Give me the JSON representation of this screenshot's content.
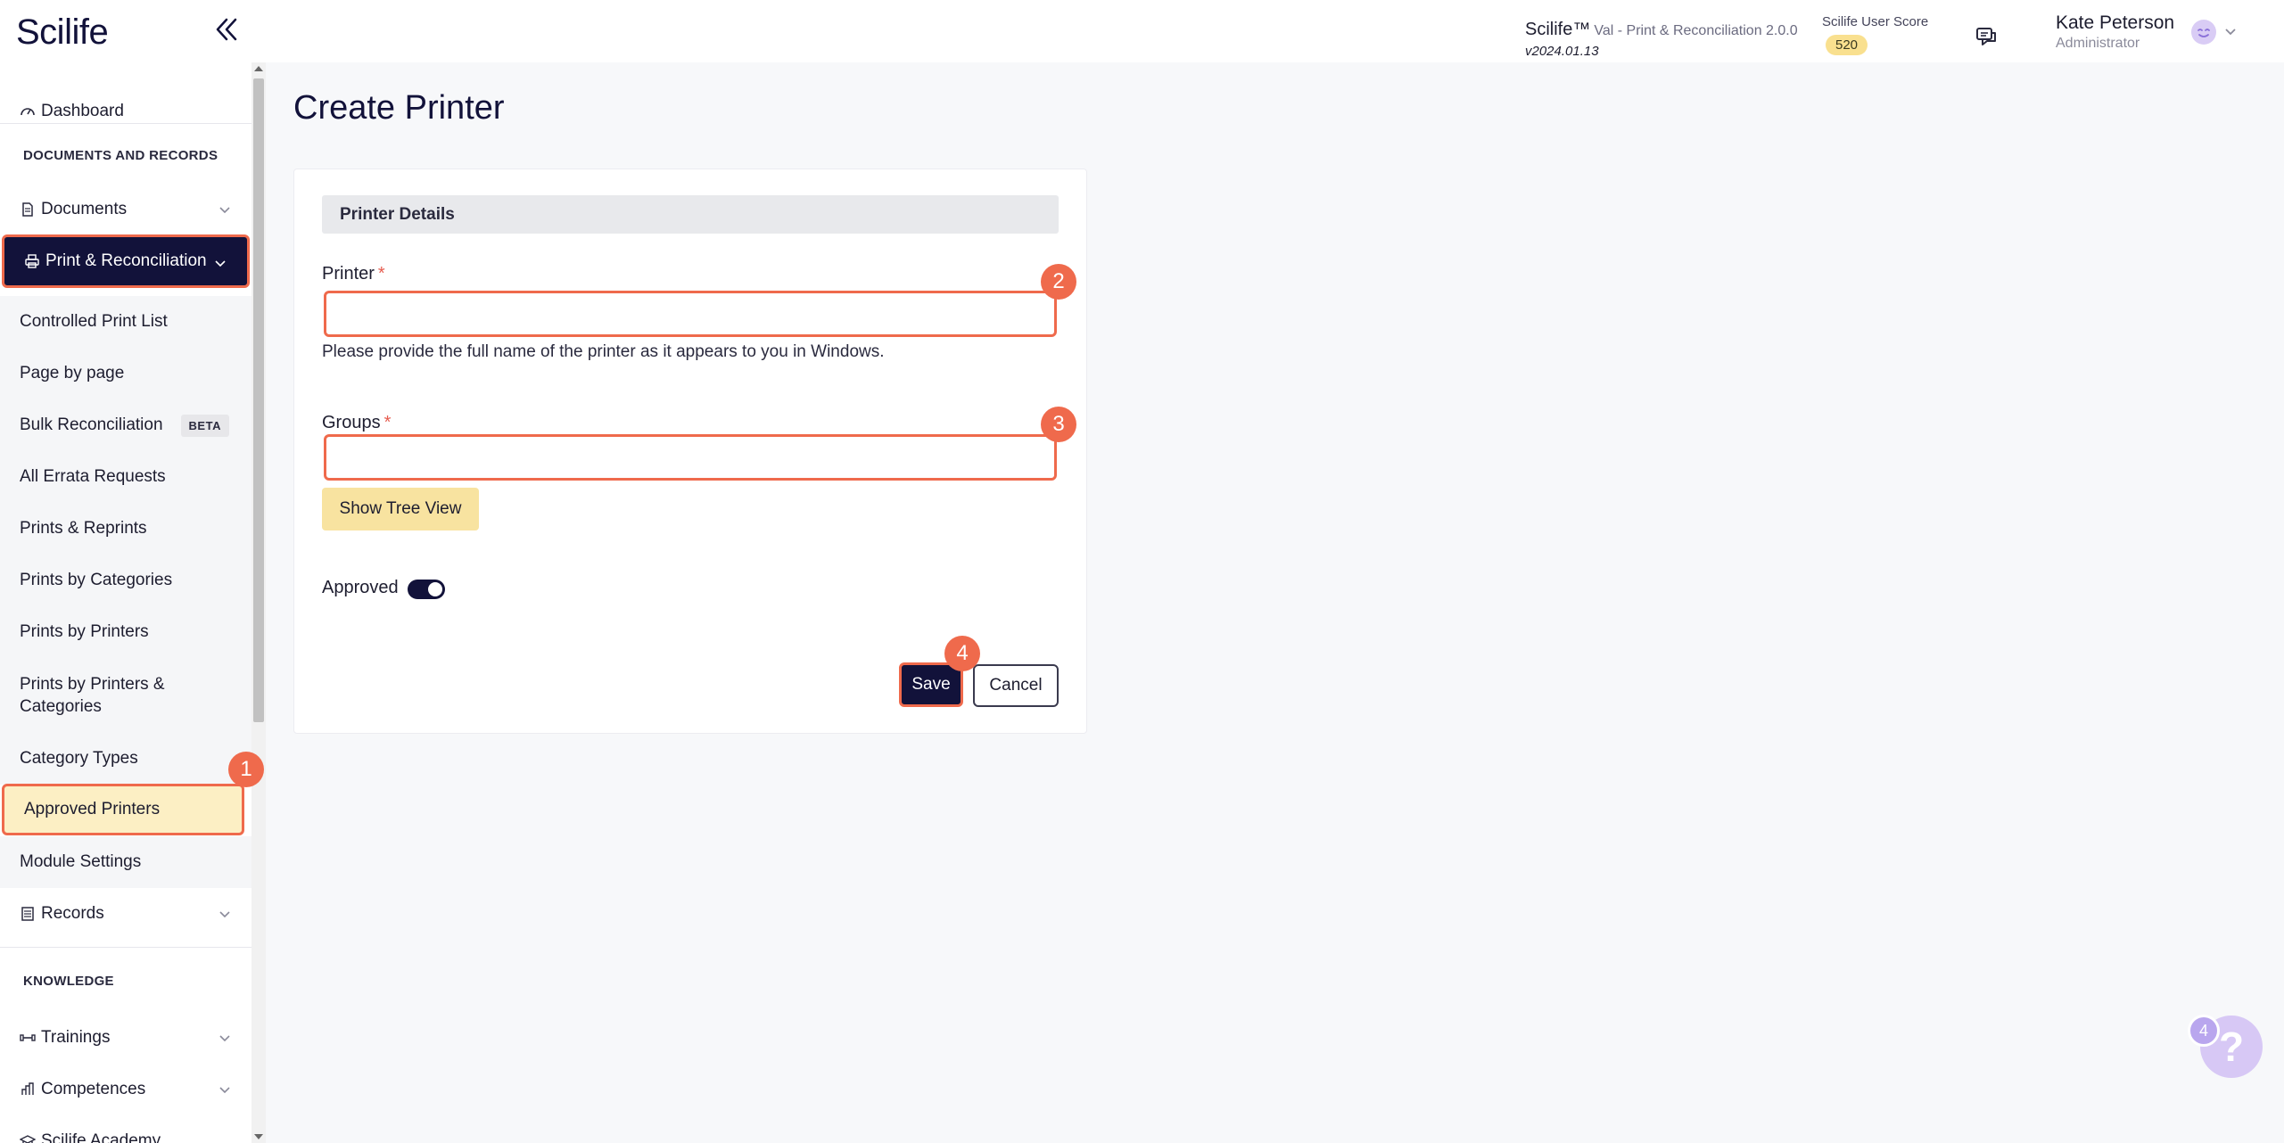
{
  "header": {
    "logo": "Scilife",
    "app_name": "Scilife™",
    "module": "Val - Print & Reconciliation 2.0.0",
    "version": "v2024.01.13",
    "score_label": "Scilife User Score",
    "score_value": "520",
    "user_name": "Kate Peterson",
    "user_role": "Administrator"
  },
  "sidebar": {
    "dashboard": "Dashboard",
    "section_docs": "DOCUMENTS AND RECORDS",
    "documents": "Documents",
    "print_reconciliation": "Print & Reconciliation",
    "sub_items": [
      "Controlled Print List",
      "Page by page",
      "Bulk Reconciliation",
      "All Errata Requests",
      "Prints & Reprints",
      "Prints by Categories",
      "Prints by Printers",
      "Prints by Printers & Categories",
      "Category Types",
      "Approved Printers",
      "Module Settings"
    ],
    "beta_badge": "BETA",
    "records": "Records",
    "section_knowledge": "KNOWLEDGE",
    "trainings": "Trainings",
    "competences": "Competences",
    "academy": "Scilife Academy"
  },
  "main": {
    "title": "Create Printer",
    "section_title": "Printer Details",
    "printer_label": "Printer",
    "printer_value": "",
    "printer_help": "Please provide the full name of the printer as it appears to you in Windows.",
    "groups_label": "Groups",
    "groups_value": "",
    "required_mark": "*",
    "tree_view_button": "Show Tree View",
    "approved_label": "Approved",
    "approved_on": true,
    "save_button": "Save",
    "cancel_button": "Cancel"
  },
  "markers": [
    "1",
    "2",
    "3",
    "4"
  ],
  "help": {
    "count": "4",
    "icon": "?"
  },
  "colors": {
    "navy": "#12123a",
    "highlight": "#ef6a4c",
    "active_item_bg": "#fcefc4",
    "tree_button_bg": "#f8e3a0",
    "score_badge": "#f9e08f"
  }
}
